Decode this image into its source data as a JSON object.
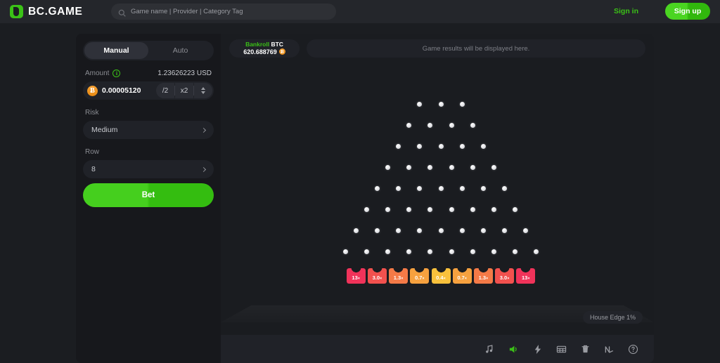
{
  "header": {
    "brand": "BC.GAME",
    "search_placeholder": "Game name | Provider | Category Tag",
    "sign_in": "Sign in",
    "sign_up": "Sign up",
    "accent_green": "#3bc117"
  },
  "panel": {
    "modes": [
      {
        "label": "Manual",
        "active": true
      },
      {
        "label": "Auto",
        "active": false
      }
    ],
    "amount": {
      "label": "Amount",
      "fiat_value": "1.23626223 USD",
      "value": "0.00005120",
      "coin_symbol": "Ƀ",
      "half_label": "/2",
      "double_label": "x2"
    },
    "risk": {
      "label": "Risk",
      "value": "Medium"
    },
    "row": {
      "label": "Row",
      "value": "8"
    },
    "bet_button": "Bet"
  },
  "game": {
    "bankroll": {
      "label": "Bankroll",
      "currency": "BTC",
      "value": "620.688769",
      "coin_symbol": "Ƀ"
    },
    "results_placeholder": "Game results will be displayed here.",
    "house_edge": "House Edge 1%",
    "peg_rows": [
      3,
      4,
      5,
      6,
      7,
      8,
      9,
      10
    ],
    "buckets": [
      {
        "label": "13",
        "suffix": "×",
        "color": "#f0335a"
      },
      {
        "label": "3.0",
        "suffix": "×",
        "color": "#f2514e"
      },
      {
        "label": "1.3",
        "suffix": "×",
        "color": "#f47a47"
      },
      {
        "label": "0.7",
        "suffix": "×",
        "color": "#f6a13f"
      },
      {
        "label": "0.4",
        "suffix": "×",
        "color": "#f9c13c"
      },
      {
        "label": "0.7",
        "suffix": "×",
        "color": "#f6a13f"
      },
      {
        "label": "1.3",
        "suffix": "×",
        "color": "#f47a47"
      },
      {
        "label": "3.0",
        "suffix": "×",
        "color": "#f2514e"
      },
      {
        "label": "13",
        "suffix": "×",
        "color": "#f0335a"
      }
    ],
    "toolbar": [
      {
        "icon": "music-note-icon",
        "active": false
      },
      {
        "icon": "volume-icon",
        "active": true
      },
      {
        "icon": "lightning-icon",
        "active": false
      },
      {
        "icon": "table-icon",
        "active": false
      },
      {
        "icon": "trash-icon",
        "active": false
      },
      {
        "icon": "chart-icon",
        "active": false
      },
      {
        "icon": "help-icon",
        "active": false
      }
    ]
  }
}
